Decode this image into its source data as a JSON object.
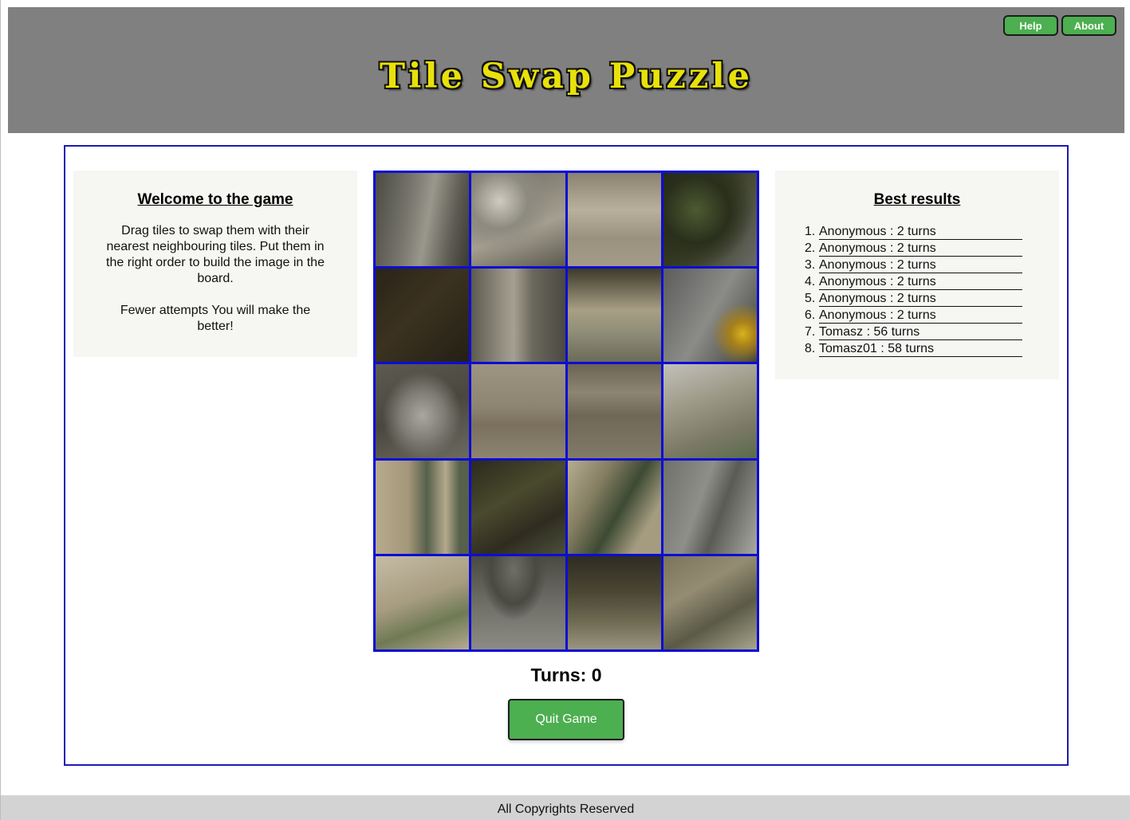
{
  "header": {
    "title": "Tile Swap Puzzle",
    "help_label": "Help",
    "about_label": "About"
  },
  "welcome": {
    "heading": "Welcome to the game",
    "paragraph1": "Drag tiles to swap them with their nearest neighbouring tiles. Put them in the right order to build the image in the board.",
    "paragraph2": "Fewer attempts You will make the better!"
  },
  "results": {
    "heading": "Best results",
    "entries": [
      "Anonymous : 2 turns",
      "Anonymous : 2 turns",
      "Anonymous : 2 turns",
      "Anonymous : 2 turns",
      "Anonymous : 2 turns",
      "Anonymous : 2 turns",
      "Tomasz : 56 turns",
      "Tomasz01 : 58 turns"
    ]
  },
  "board": {
    "columns": 4,
    "rows": 5,
    "tiles": [
      "gray-arm",
      "hand-pipe",
      "street-people",
      "dark-trees",
      "dark-foliage",
      "pipe-cane",
      "building-window",
      "shoulder-yellow",
      "face-hat",
      "stone-wall",
      "stone-ledge",
      "building-sky",
      "building-windows",
      "trees-dark",
      "building-green",
      "coat-arm",
      "building-light",
      "hat-torso",
      "street-dark",
      "building-statue"
    ]
  },
  "status": {
    "turns_text": "Turns: 0",
    "quit_label": "Quit Game"
  },
  "footer": {
    "text": "All Copyrights Reserved"
  },
  "colors": {
    "header_bg": "#808080",
    "title": "#e8e10a",
    "accent_green": "#4caf50",
    "board_border": "#0c0cd6",
    "frame_border": "#1b1bb3",
    "panel_bg": "#f6f7f2",
    "footer_bg": "#d3d3d3"
  }
}
